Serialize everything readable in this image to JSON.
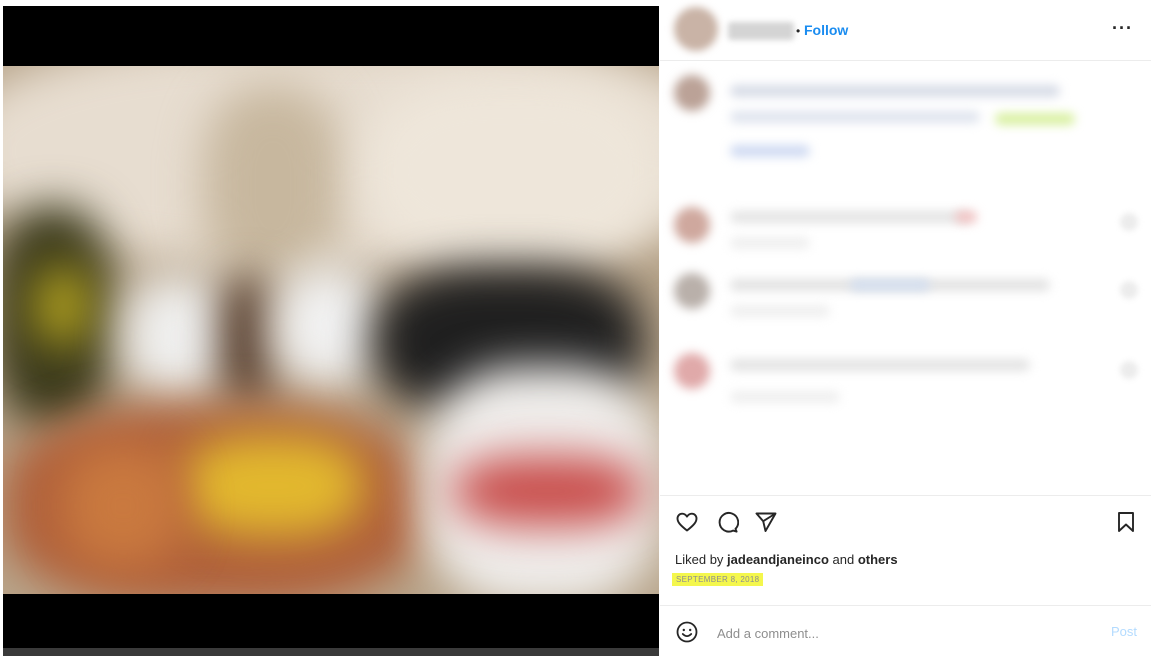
{
  "header": {
    "separator": "•",
    "follow_label": "Follow",
    "more_label": "···"
  },
  "engagement": {
    "liked_by_prefix": "Liked by ",
    "liked_by_user": "jadeandjaneinco",
    "liked_by_and": " and ",
    "liked_by_others": "others",
    "date": "SEPTEMBER 8, 2018"
  },
  "composer": {
    "placeholder": "Add a comment...",
    "post_label": "Post"
  },
  "icons": {
    "like": "heart-icon",
    "comment": "comment-icon",
    "share": "paper-plane-icon",
    "save": "bookmark-icon",
    "emoji": "smiley-icon",
    "more": "more-dots-icon"
  },
  "colors": {
    "follow": "#1a8cf0",
    "post_disabled": "#b3dbff",
    "date_highlight": "#f4f74d",
    "text": "#262626",
    "muted": "#8e8e8e"
  }
}
